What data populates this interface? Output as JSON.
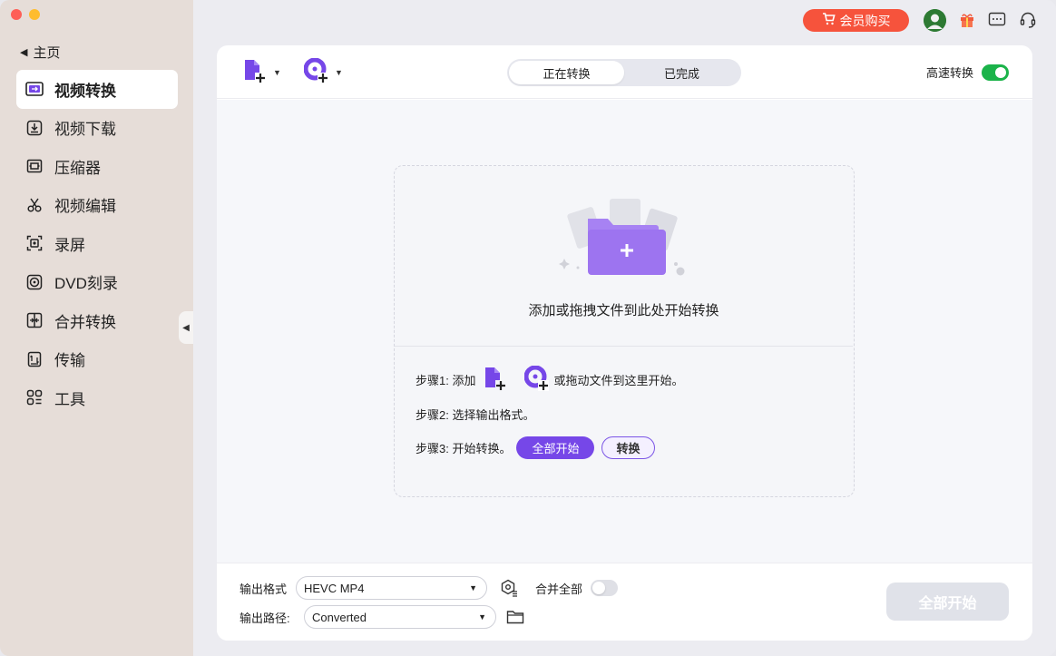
{
  "sidebar": {
    "home_label": "主页",
    "items": [
      {
        "label": "视频转换",
        "icon": "video-convert-icon",
        "active": true
      },
      {
        "label": "视频下载",
        "icon": "download-icon",
        "active": false
      },
      {
        "label": "压缩器",
        "icon": "compress-icon",
        "active": false
      },
      {
        "label": "视频编辑",
        "icon": "scissors-icon",
        "active": false
      },
      {
        "label": "录屏",
        "icon": "screen-record-icon",
        "active": false
      },
      {
        "label": "DVD刻录",
        "icon": "disc-icon",
        "active": false
      },
      {
        "label": "合并转换",
        "icon": "merge-icon",
        "active": false
      },
      {
        "label": "传输",
        "icon": "transfer-icon",
        "active": false
      },
      {
        "label": "工具",
        "icon": "grid-icon",
        "active": false
      }
    ]
  },
  "topbar": {
    "vip_label": "会员购买"
  },
  "toolbar": {
    "tabs": [
      {
        "label": "正在转换",
        "active": true
      },
      {
        "label": "已完成",
        "active": false
      }
    ],
    "speed_label": "高速转换",
    "speed_on": true
  },
  "dropzone": {
    "hint": "添加或拖拽文件到此处开始转换",
    "step1_prefix": "步骤1:  添加",
    "step1_suffix": "或拖动文件到这里开始。",
    "step2": "步骤2:  选择输出格式。",
    "step3_prefix": "步骤3:  开始转换。",
    "start_all_label": "全部开始",
    "convert_label": "转换"
  },
  "bottom": {
    "format_label": "输出格式",
    "format_value": "HEVC MP4",
    "merge_label": "合并全部",
    "merge_on": false,
    "path_label": "输出路径:",
    "path_value": "Converted",
    "start_all_label": "全部开始"
  },
  "colors": {
    "accent": "#7647e8",
    "vip": "#f6533c",
    "toggle_on": "#1bb34a"
  }
}
